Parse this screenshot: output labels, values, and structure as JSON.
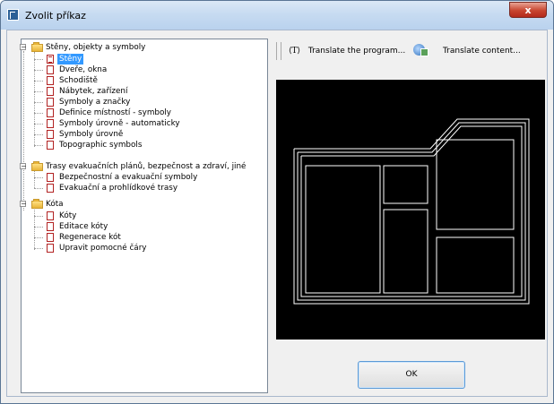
{
  "window": {
    "title": "Zvolit příkaz",
    "close_label": "x"
  },
  "tree": {
    "groups": [
      {
        "label": "Stěny, objekty a symboly",
        "items": [
          "Stěny",
          "Dveře, okna",
          "Schodiště",
          "Nábytek, zařízení",
          "Symboly a značky",
          "Definice místností - symboly",
          "Symboly úrovně - automaticky",
          "Symboly úrovně",
          "Topographic symbols"
        ]
      },
      {
        "label": "Trasy evakuačních plánů, bezpečnost a zdraví, jiné",
        "items": [
          "Bezpečnostní a evakuační symboly",
          "Evakuační a prohlídkové trasy"
        ]
      },
      {
        "label": "Kóta",
        "items": [
          "Kóty",
          "Editace kóty",
          "Regenerace kót",
          "Upravit pomocné čáry"
        ]
      }
    ],
    "selected_item": "Stěny"
  },
  "toolbar": {
    "translate_program_icon": "⟨T⟩",
    "translate_program_label": "Translate the program...",
    "translate_content_label": "Translate content..."
  },
  "buttons": {
    "ok_label": "OK"
  }
}
